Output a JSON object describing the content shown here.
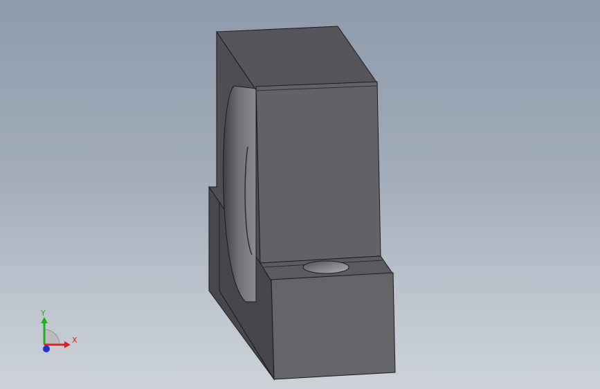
{
  "viewport": {
    "background_top": "#8e9aab",
    "background_bottom": "#cdd2d9"
  },
  "model": {
    "body_color": "#626266",
    "edge_color": "#1a1a1c",
    "bore_color": "#8a8a90"
  },
  "triad": {
    "x_label": "X",
    "y_label": "Y",
    "x_color": "#e02020",
    "y_color": "#20b020",
    "z_color": "#2030d0"
  }
}
